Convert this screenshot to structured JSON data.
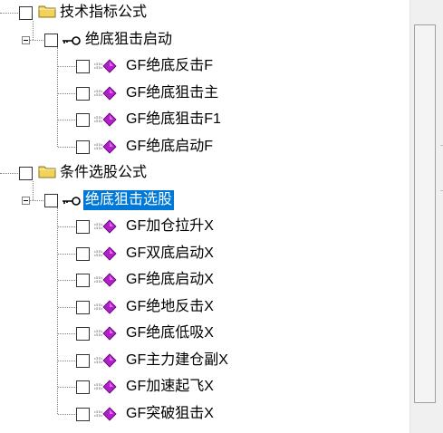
{
  "tree": {
    "groups": [
      {
        "label": "技术指标公式",
        "icon": "folder-icon",
        "children": [
          {
            "label": "绝底狙击启动",
            "icon": "key-icon",
            "selected": false,
            "items": [
              {
                "label": "GF绝底反击F",
                "icon": "formula-icon"
              },
              {
                "label": "GF绝底狙击主",
                "icon": "formula-icon"
              },
              {
                "label": "GF绝底狙击F1",
                "icon": "formula-icon"
              },
              {
                "label": "GF绝底启动F",
                "icon": "formula-icon"
              }
            ]
          }
        ]
      },
      {
        "label": "条件选股公式",
        "icon": "folder-icon",
        "children": [
          {
            "label": "绝底狙击选股",
            "icon": "key-icon",
            "selected": true,
            "items": [
              {
                "label": "GF加仓拉升X",
                "icon": "formula-icon"
              },
              {
                "label": "GF双底启动X",
                "icon": "formula-icon"
              },
              {
                "label": "GF绝底启动X",
                "icon": "formula-icon"
              },
              {
                "label": "GF绝地反击X",
                "icon": "formula-icon"
              },
              {
                "label": "GF绝底低吸X",
                "icon": "formula-icon"
              },
              {
                "label": "GF主力建仓副X",
                "icon": "formula-icon"
              },
              {
                "label": "GF加速起飞X",
                "icon": "formula-icon"
              },
              {
                "label": "GF突破狙击X",
                "icon": "formula-icon"
              }
            ]
          }
        ]
      }
    ]
  },
  "colors": {
    "selection": "#0078d7",
    "folder": "#f2d25a",
    "formula_diamond": "#b01fc8",
    "tree_line": "#808080"
  }
}
